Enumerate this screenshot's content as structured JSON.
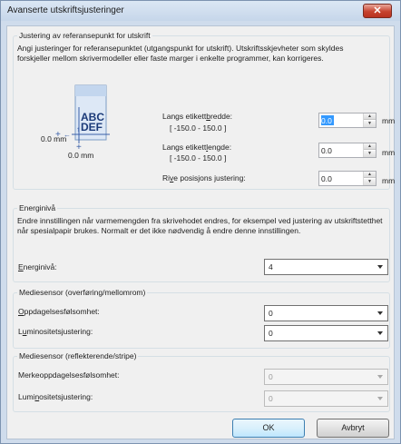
{
  "window": {
    "title": "Avanserte utskriftsjusteringer",
    "close_glyph": "✕"
  },
  "reference": {
    "legend": "Justering av referansepunkt for utskrift",
    "description": "Angi justeringer for referansepunktet (utgangspunkt for utskrift). Utskriftsskjevheter som skyldes forskjeller mellom skrivermodeller eller faste marger i enkelte programmer, kan korrigeres.",
    "diagram_text_1": "ABC",
    "diagram_text_2": "DEF",
    "origin_x_label": "0.0 mm",
    "origin_y_label": "0.0 mm",
    "width": {
      "label_pre": "Langs etikett",
      "label_u": "b",
      "label_post": "redde:",
      "range": "[ -150.0 - 150.0 ]",
      "value": "0.0",
      "unit": "mm"
    },
    "length": {
      "label_pre": "Langs etikett",
      "label_u": "l",
      "label_post": "engde:",
      "range": "[ -150.0 - 150.0 ]",
      "value": "0.0",
      "unit": "mm"
    },
    "tear": {
      "label_pre": "Ri",
      "label_u": "v",
      "label_post": "e posisjons justering:",
      "value": "0.0",
      "unit": "mm"
    }
  },
  "energy": {
    "legend": "Energinivå",
    "description": "Endre innstillingen når varmemengden fra skrivehodet endres, for eksempel ved justering av utskriftstetthet når spesialpapir brukes. Normalt er det ikke nødvendig å endre denne innstillingen.",
    "label_u": "E",
    "label_post": "nerginivå:",
    "value": "4"
  },
  "sensor_trans": {
    "legend": "Mediesensor (overføring/mellomrom)",
    "detect_label_u": "O",
    "detect_label_post": "ppdagelsesfølsomhet:",
    "detect_value": "0",
    "lum_label_pre": "L",
    "lum_label_u": "u",
    "lum_label_post": "minositetsjustering:",
    "lum_value": "0"
  },
  "sensor_refl": {
    "legend": "Mediesensor (reflekterende/stripe)",
    "mark_label": "Merkeoppdagelsesfølsomhet:",
    "mark_value": "0",
    "lum_label_pre": "Lumi",
    "lum_label_u": "n",
    "lum_label_post": "ositetsjustering:",
    "lum_value": "0"
  },
  "buttons": {
    "ok": "OK",
    "cancel": "Avbryt"
  }
}
